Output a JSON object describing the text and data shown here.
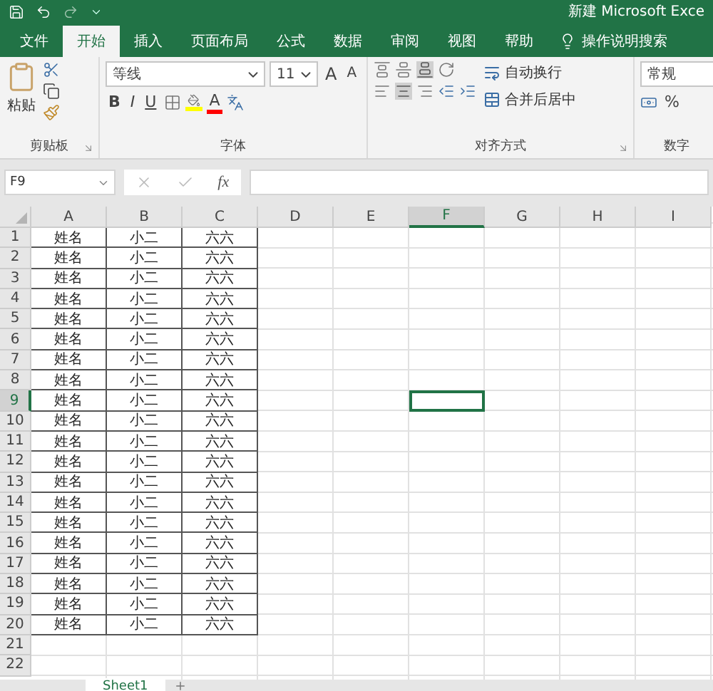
{
  "window": {
    "title": "新建 Microsoft Exce"
  },
  "ribbon_tabs": [
    {
      "label": "文件",
      "selected": false
    },
    {
      "label": "开始",
      "selected": true
    },
    {
      "label": "插入",
      "selected": false
    },
    {
      "label": "页面布局",
      "selected": false
    },
    {
      "label": "公式",
      "selected": false
    },
    {
      "label": "数据",
      "selected": false
    },
    {
      "label": "审阅",
      "selected": false
    },
    {
      "label": "视图",
      "selected": false
    },
    {
      "label": "帮助",
      "selected": false
    }
  ],
  "tell_me": "操作说明搜索",
  "clipboard": {
    "paste": "粘贴",
    "group": "剪贴板"
  },
  "font": {
    "name": "等线",
    "size": "11",
    "size_buttons": [
      "A",
      "A"
    ],
    "format_buttons": [
      "B",
      "I",
      "U"
    ],
    "font_color": "A",
    "group": "字体"
  },
  "alignment": {
    "wrap": "自动换行",
    "merge": "合并后居中",
    "group": "对齐方式"
  },
  "number": {
    "format": "常规",
    "percent": "%",
    "group": "数字"
  },
  "formula_bar": {
    "name_box": "F9",
    "fx": "fx"
  },
  "columns": [
    {
      "label": "A",
      "selected": false
    },
    {
      "label": "B",
      "selected": false
    },
    {
      "label": "C",
      "selected": false
    },
    {
      "label": "D",
      "selected": false
    },
    {
      "label": "E",
      "selected": false
    },
    {
      "label": "F",
      "selected": true
    },
    {
      "label": "G",
      "selected": false
    },
    {
      "label": "H",
      "selected": false
    },
    {
      "label": "I",
      "selected": false
    }
  ],
  "rows": [
    {
      "label": "1",
      "selected": false,
      "cells": [
        "姓名",
        "小二",
        "六六"
      ]
    },
    {
      "label": "2",
      "selected": false,
      "cells": [
        "姓名",
        "小二",
        "六六"
      ]
    },
    {
      "label": "3",
      "selected": false,
      "cells": [
        "姓名",
        "小二",
        "六六"
      ]
    },
    {
      "label": "4",
      "selected": false,
      "cells": [
        "姓名",
        "小二",
        "六六"
      ]
    },
    {
      "label": "5",
      "selected": false,
      "cells": [
        "姓名",
        "小二",
        "六六"
      ]
    },
    {
      "label": "6",
      "selected": false,
      "cells": [
        "姓名",
        "小二",
        "六六"
      ]
    },
    {
      "label": "7",
      "selected": false,
      "cells": [
        "姓名",
        "小二",
        "六六"
      ]
    },
    {
      "label": "8",
      "selected": false,
      "cells": [
        "姓名",
        "小二",
        "六六"
      ]
    },
    {
      "label": "9",
      "selected": true,
      "cells": [
        "姓名",
        "小二",
        "六六"
      ]
    },
    {
      "label": "10",
      "selected": false,
      "cells": [
        "姓名",
        "小二",
        "六六"
      ]
    },
    {
      "label": "11",
      "selected": false,
      "cells": [
        "姓名",
        "小二",
        "六六"
      ]
    },
    {
      "label": "12",
      "selected": false,
      "cells": [
        "姓名",
        "小二",
        "六六"
      ]
    },
    {
      "label": "13",
      "selected": false,
      "cells": [
        "姓名",
        "小二",
        "六六"
      ]
    },
    {
      "label": "14",
      "selected": false,
      "cells": [
        "姓名",
        "小二",
        "六六"
      ]
    },
    {
      "label": "15",
      "selected": false,
      "cells": [
        "姓名",
        "小二",
        "六六"
      ]
    },
    {
      "label": "16",
      "selected": false,
      "cells": [
        "姓名",
        "小二",
        "六六"
      ]
    },
    {
      "label": "17",
      "selected": false,
      "cells": [
        "姓名",
        "小二",
        "六六"
      ]
    },
    {
      "label": "18",
      "selected": false,
      "cells": [
        "姓名",
        "小二",
        "六六"
      ]
    },
    {
      "label": "19",
      "selected": false,
      "cells": [
        "姓名",
        "小二",
        "六六"
      ]
    },
    {
      "label": "20",
      "selected": false,
      "cells": [
        "姓名",
        "小二",
        "六六"
      ]
    },
    {
      "label": "21",
      "selected": false,
      "cells": []
    },
    {
      "label": "22",
      "selected": false,
      "cells": []
    }
  ],
  "sheets": [
    {
      "name": "Sheet1",
      "selected": true
    }
  ]
}
